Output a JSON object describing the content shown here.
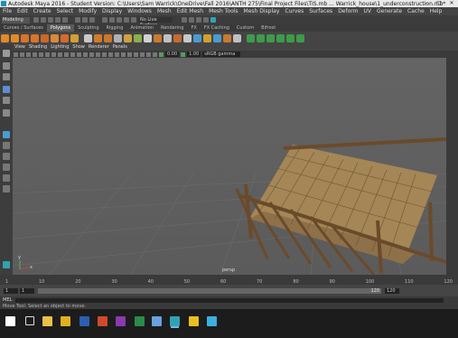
{
  "app": {
    "title": "Autodesk Maya 2016 - Student Version: C:\\Users\\Sam Warrick\\OneDrive\\Fall 2016\\ANTH 275\\Final Project Files\\TIS.mb ... Warrick_house\\1_underconstruction.mb*",
    "window_buttons": [
      "–",
      "□",
      "✕"
    ]
  },
  "menubar": {
    "items": [
      "File",
      "Edit",
      "Create",
      "Select",
      "Modify",
      "Display",
      "Windows",
      "Mesh",
      "Edit Mesh",
      "Mesh Tools",
      "Mesh Display",
      "Curves",
      "Surfaces",
      "Deform",
      "UV",
      "Generate",
      "Cache",
      "Help"
    ]
  },
  "statusline": {
    "workspace": "Modeling",
    "live_surface": "No Live Surface"
  },
  "shelf": {
    "tabs": [
      "Curves / Surfaces",
      "Polygons",
      "Sculpting",
      "Rigging",
      "Animation",
      "Rendering",
      "FX",
      "FX Caching",
      "Custom",
      "Bifrost"
    ],
    "active_tab": "Polygons",
    "icon_colors": [
      "#e08a2b",
      "#e08a2b",
      "#d9742a",
      "#d9742a",
      "#c96a2a",
      "#d88a3c",
      "#d36b2b",
      "#d0a030",
      "#c8c8c8",
      "#d57a2a",
      "#c9772a",
      "#b0b0b0",
      "#d0a040",
      "#8ab04a",
      "#d0d0d0",
      "#c87a30",
      "#c0c0c0",
      "#c86a30",
      "#c8c8c8",
      "#4a9bd0",
      "#d0a030",
      "#4a9bd0",
      "#c87a30",
      "#c0c0c0",
      "#3f9a4a",
      "#3f9a4a",
      "#3f9a4a",
      "#3f9a4a",
      "#3f9a4a",
      "#3f9a4a"
    ]
  },
  "panel": {
    "menu": [
      "View",
      "Shading",
      "Lighting",
      "Show",
      "Renderer",
      "Panels"
    ],
    "field_1": "0.00",
    "field_2": "1.00",
    "color_space": "sRGB gamma"
  },
  "viewport": {
    "camera_label": "persp",
    "axis_labels": [
      "x",
      "y"
    ]
  },
  "timeslider": {
    "ticks": [
      "1",
      "10",
      "20",
      "30",
      "40",
      "50",
      "60",
      "70",
      "80",
      "90",
      "100",
      "110",
      "120"
    ],
    "current_frame": "1"
  },
  "rangebar": {
    "start": "1",
    "start_field": "1",
    "range_end": "120",
    "end": "120"
  },
  "cmdline": {
    "label": "MEL"
  },
  "helpline": {
    "text": "Move Tool: Select an object to move."
  },
  "taskbar": {
    "apps": [
      {
        "name": "windows-start",
        "color": "#ffffff"
      },
      {
        "name": "task-view",
        "color": "#ffffff"
      },
      {
        "name": "file-explorer",
        "color": "#e8c04a"
      },
      {
        "name": "chrome",
        "color": "#e0b020"
      },
      {
        "name": "word",
        "color": "#2b5fb3"
      },
      {
        "name": "powerpoint",
        "color": "#d04a2a"
      },
      {
        "name": "onenote",
        "color": "#8a3ab0"
      },
      {
        "name": "excel",
        "color": "#2b8a4a"
      },
      {
        "name": "visual-studio",
        "color": "#68a0e0"
      },
      {
        "name": "maya",
        "color": "#2fa3b3"
      },
      {
        "name": "sticky-notes",
        "color": "#e8c020"
      },
      {
        "name": "paint",
        "color": "#3ab0e0"
      }
    ]
  }
}
